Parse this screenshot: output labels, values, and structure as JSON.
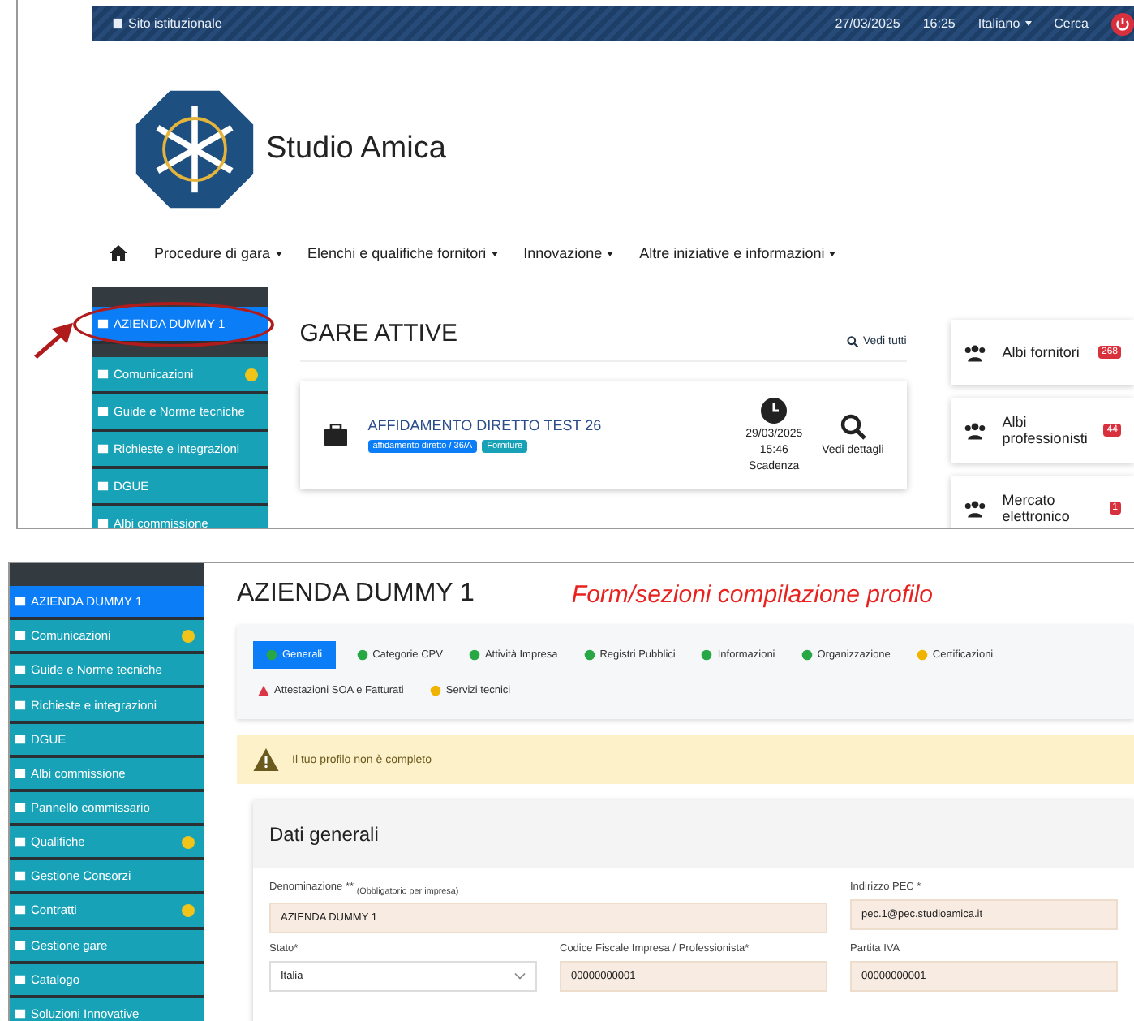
{
  "top": {
    "topbar": {
      "site_link": "Sito istituzionale",
      "date": "27/03/2025",
      "time": "16:25",
      "language": "Italiano",
      "search": "Cerca"
    },
    "brand": "Studio Amica",
    "nav": [
      "Procedure di gara",
      "Elenchi e qualifiche fornitori",
      "Innovazione",
      "Altre iniziative e informazioni"
    ],
    "sidebar": [
      {
        "label": "AZIENDA DUMMY 1",
        "selected": true,
        "dot": false
      },
      {
        "label": "Comunicazioni",
        "selected": false,
        "dot": true
      },
      {
        "label": "Guide e Norme tecniche",
        "selected": false,
        "dot": false
      },
      {
        "label": "Richieste e integrazioni",
        "selected": false,
        "dot": false
      },
      {
        "label": "DGUE",
        "selected": false,
        "dot": false
      },
      {
        "label": "Albi commissione",
        "selected": false,
        "dot": false
      }
    ],
    "section_title": "GARE ATTIVE",
    "see_all": "Vedi tutti",
    "tender": {
      "title": "AFFIDAMENTO DIRETTO TEST 26",
      "tags": [
        "affidamento diretto / 36/A",
        "Forniture"
      ],
      "date": "29/03/2025",
      "time": "15:46",
      "deadline_label": "Scadenza",
      "details": "Vedi dettagli"
    },
    "right_cards": [
      {
        "label": "Albi fornitori",
        "badge": "268"
      },
      {
        "label": "Albi professionisti",
        "badge": "44"
      },
      {
        "label": "Mercato elettronico",
        "badge": "1"
      }
    ]
  },
  "annotation": "Form/sezioni compilazione profilo",
  "bottom": {
    "sidebar": [
      {
        "label": "AZIENDA DUMMY 1",
        "selected": true,
        "dot": false
      },
      {
        "label": "Comunicazioni",
        "selected": false,
        "dot": true
      },
      {
        "label": "Guide e Norme tecniche",
        "selected": false,
        "dot": false
      },
      {
        "label": "Richieste e integrazioni",
        "selected": false,
        "dot": false
      },
      {
        "label": "DGUE",
        "selected": false,
        "dot": false
      },
      {
        "label": "Albi commissione",
        "selected": false,
        "dot": false
      },
      {
        "label": "Pannello commissario",
        "selected": false,
        "dot": false
      },
      {
        "label": "Qualifiche",
        "selected": false,
        "dot": true
      },
      {
        "label": "Gestione Consorzi",
        "selected": false,
        "dot": false
      },
      {
        "label": "Contratti",
        "selected": false,
        "dot": true
      },
      {
        "label": "Gestione gare",
        "selected": false,
        "dot": false
      },
      {
        "label": "Catalogo",
        "selected": false,
        "dot": false
      },
      {
        "label": "Soluzioni Innovative",
        "selected": false,
        "dot": false
      }
    ],
    "title": "AZIENDA DUMMY 1",
    "tabs": [
      {
        "label": "Generali",
        "selected": true,
        "kind": "dot",
        "color": "#28a745"
      },
      {
        "label": "Categorie CPV",
        "selected": false,
        "kind": "dot",
        "color": "#28a745"
      },
      {
        "label": "Attività Impresa",
        "selected": false,
        "kind": "dot",
        "color": "#28a745"
      },
      {
        "label": "Registri Pubblici",
        "selected": false,
        "kind": "dot",
        "color": "#28a745"
      },
      {
        "label": "Informazioni",
        "selected": false,
        "kind": "dot",
        "color": "#28a745"
      },
      {
        "label": "Organizzazione",
        "selected": false,
        "kind": "dot",
        "color": "#28a745"
      },
      {
        "label": "Certificazioni",
        "selected": false,
        "kind": "dot",
        "color": "#f0b400"
      },
      {
        "label": "Attestazioni SOA e Fatturati",
        "selected": false,
        "kind": "warning",
        "color": "#dc3545"
      },
      {
        "label": "Servizi tecnici",
        "selected": false,
        "kind": "dot",
        "color": "#f0b400"
      }
    ],
    "alert": "Il tuo profilo non è completo",
    "card_title": "Dati generali",
    "fields": [
      {
        "label": "Denominazione ** $_{(Obbligatorio per impresa)}$",
        "value": "AZIENDA DUMMY 1",
        "kind": "input"
      },
      {
        "label": "Indirizzo PEC *",
        "value": "pec.1@pec.studioamica.it",
        "kind": "input"
      },
      {
        "label": "Stato*",
        "value": "Italia",
        "kind": "select"
      },
      {
        "label": "Codice Fiscale Impresa / Professionista*",
        "value": "00000000001",
        "kind": "input"
      },
      {
        "label": "Partita IVA",
        "value": "00000000001",
        "kind": "input"
      }
    ]
  }
}
